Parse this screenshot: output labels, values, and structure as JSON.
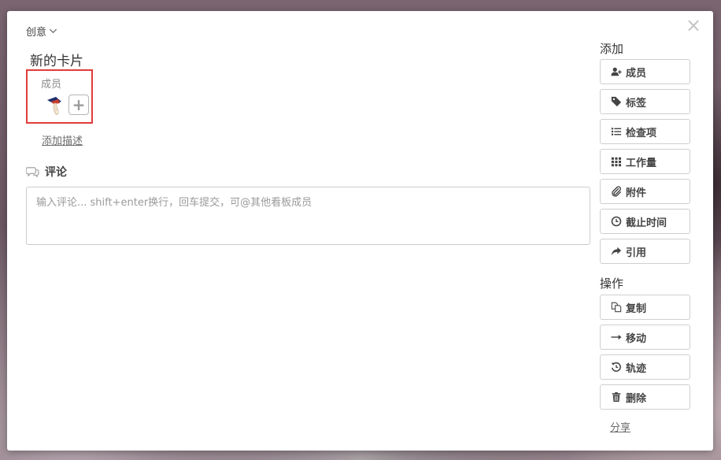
{
  "close_glyph": "×",
  "board": {
    "name": "创意"
  },
  "card": {
    "title": "新的卡片"
  },
  "members": {
    "label": "成员",
    "add_glyph": "+"
  },
  "description": {
    "link": "添加描述"
  },
  "comments": {
    "title": "评论",
    "placeholder": "输入评论... shift+enter换行，回车提交，可@其他看板成员"
  },
  "sidebar": {
    "add_title": "添加",
    "add_buttons": [
      {
        "label": "成员",
        "icon": "add-user-icon"
      },
      {
        "label": "标签",
        "icon": "tag-icon"
      },
      {
        "label": "检查项",
        "icon": "list-icon"
      },
      {
        "label": "工作量",
        "icon": "grid-icon"
      },
      {
        "label": "附件",
        "icon": "paperclip-icon"
      },
      {
        "label": "截止时间",
        "icon": "clock-icon"
      },
      {
        "label": "引用",
        "icon": "share-arrow-icon"
      }
    ],
    "actions_title": "操作",
    "action_buttons": [
      {
        "label": "复制",
        "icon": "copy-icon"
      },
      {
        "label": "移动",
        "icon": "arrow-right-icon"
      },
      {
        "label": "轨迹",
        "icon": "history-icon"
      },
      {
        "label": "删除",
        "icon": "trash-icon"
      }
    ],
    "share": "分享"
  },
  "colors": {
    "highlight_border": "#e23b3b",
    "button_border": "#cfcfcf",
    "text": "#444444"
  }
}
